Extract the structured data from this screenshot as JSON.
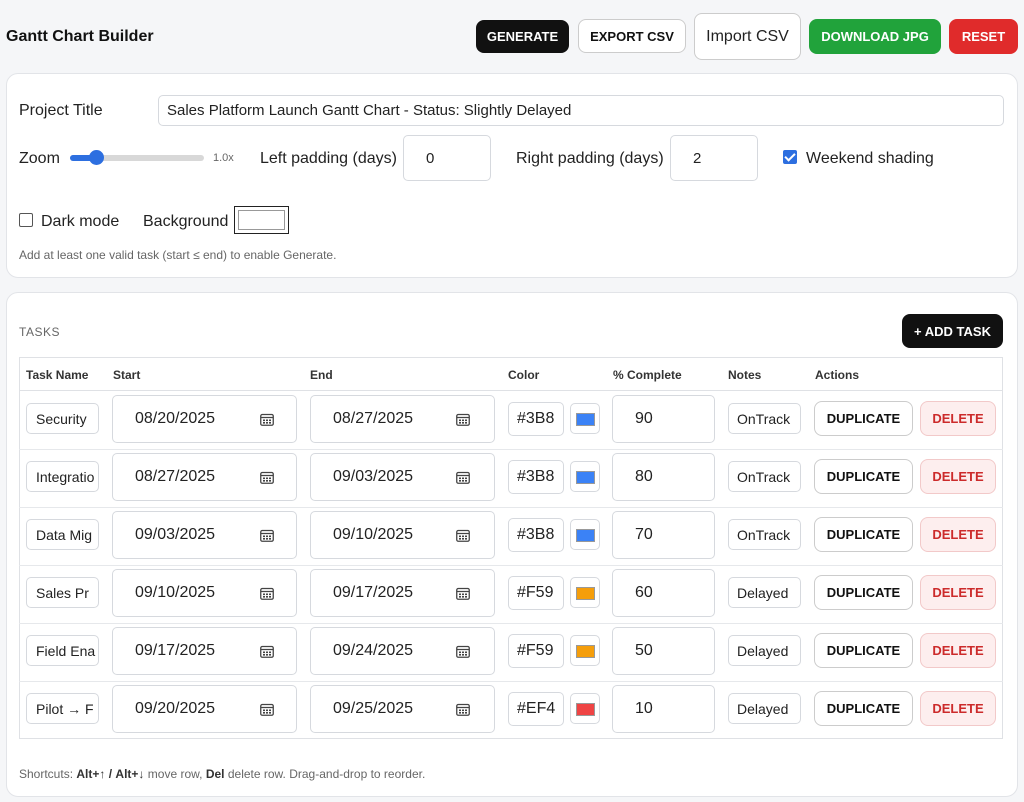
{
  "app": {
    "title": "Gantt Chart Builder"
  },
  "toolbar": {
    "generate": "GENERATE",
    "export_csv": "EXPORT CSV",
    "import_csv": "Import CSV",
    "download_jpg": "DOWNLOAD JPG",
    "reset": "RESET"
  },
  "settings": {
    "project_title_label": "Project Title",
    "project_title_value": "Sales Platform Launch Gantt Chart - Status: Slightly Delayed",
    "zoom_label": "Zoom",
    "zoom_value": "1.0x",
    "zoom_fraction": 0.2,
    "left_padding_label": "Left padding (days)",
    "left_padding_value": "0",
    "right_padding_label": "Right padding (days)",
    "right_padding_value": "2",
    "weekend_shading_label": "Weekend shading",
    "weekend_shading_checked": true,
    "dark_mode_label": "Dark mode",
    "dark_mode_checked": false,
    "background_label": "Background",
    "background_color": "#ffffff",
    "hint": "Add at least one valid task (start ≤ end) to enable Generate."
  },
  "tasks_panel": {
    "heading": "TASKS",
    "add_task": "+ ADD TASK",
    "columns": {
      "name": "Task Name",
      "start": "Start",
      "end": "End",
      "color": "Color",
      "complete": "% Complete",
      "notes": "Notes",
      "actions": "Actions"
    },
    "duplicate_label": "DUPLICATE",
    "delete_label": "DELETE",
    "rows": [
      {
        "name": "Security",
        "start": "08/20/2025",
        "end": "08/27/2025",
        "color_text": "#3B8",
        "color": "#3b82f6",
        "complete": "90",
        "notes": "OnTrack"
      },
      {
        "name": "Integratio",
        "start": "08/27/2025",
        "end": "09/03/2025",
        "color_text": "#3B8",
        "color": "#3b82f6",
        "complete": "80",
        "notes": "OnTrack"
      },
      {
        "name": "Data Mig",
        "start": "09/03/2025",
        "end": "09/10/2025",
        "color_text": "#3B8",
        "color": "#3b82f6",
        "complete": "70",
        "notes": "OnTrack"
      },
      {
        "name": "Sales Pr",
        "start": "09/10/2025",
        "end": "09/17/2025",
        "color_text": "#F59",
        "color": "#f59e0b",
        "complete": "60",
        "notes": "Delayed"
      },
      {
        "name": "Field Ena",
        "start": "09/17/2025",
        "end": "09/24/2025",
        "color_text": "#F59",
        "color": "#f59e0b",
        "complete": "50",
        "notes": "Delayed"
      },
      {
        "name": "Pilot → F",
        "start": "09/20/2025",
        "end": "09/25/2025",
        "color_text": "#EF4",
        "color": "#ef4444",
        "complete": "10",
        "notes": "Delayed"
      }
    ]
  },
  "footer": {
    "prefix": "Shortcuts:",
    "key_alt_up": "Alt+↑",
    "sep": "/",
    "key_alt_down": "Alt+↓",
    "move_text": "move row,",
    "key_del": "Del",
    "rest": "delete row. Drag-and-drop to reorder."
  }
}
